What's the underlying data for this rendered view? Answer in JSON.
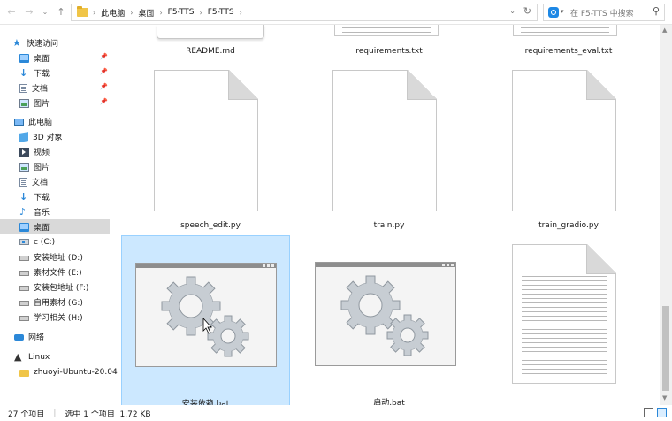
{
  "address": {
    "breadcrumbs": [
      "此电脑",
      "桌面",
      "F5-TTS",
      "F5-TTS"
    ]
  },
  "search": {
    "placeholder": "在 F5-TTS 中搜索"
  },
  "sidebar": {
    "items": [
      {
        "label": "快速访问",
        "icon": "quick-access-star",
        "pinned": false
      },
      {
        "label": "桌面",
        "icon": "desktop",
        "pinned": true
      },
      {
        "label": "下载",
        "icon": "download",
        "pinned": true
      },
      {
        "label": "文档",
        "icon": "documents",
        "pinned": true
      },
      {
        "label": "图片",
        "icon": "pictures",
        "pinned": true
      },
      {
        "label": "此电脑",
        "icon": "this-pc",
        "pinned": false
      },
      {
        "label": "3D 对象",
        "icon": "3d-objects",
        "pinned": false
      },
      {
        "label": "视频",
        "icon": "videos",
        "pinned": false
      },
      {
        "label": "图片",
        "icon": "pictures",
        "pinned": false
      },
      {
        "label": "文档",
        "icon": "documents",
        "pinned": false
      },
      {
        "label": "下载",
        "icon": "download",
        "pinned": false
      },
      {
        "label": "音乐",
        "icon": "music",
        "pinned": false
      },
      {
        "label": "桌面",
        "icon": "desktop",
        "pinned": false,
        "selected": true
      },
      {
        "label": "c (C:)",
        "icon": "drive-c",
        "pinned": false
      },
      {
        "label": "安装地址 (D:)",
        "icon": "drive",
        "pinned": false
      },
      {
        "label": "素材文件 (E:)",
        "icon": "drive",
        "pinned": false
      },
      {
        "label": "安装包地址 (F:)",
        "icon": "drive",
        "pinned": false
      },
      {
        "label": "自用素材 (G:)",
        "icon": "drive",
        "pinned": false
      },
      {
        "label": "学习相关 (H:)",
        "icon": "drive",
        "pinned": false
      },
      {
        "label": "网络",
        "icon": "network",
        "pinned": false
      },
      {
        "label": "Linux",
        "icon": "linux",
        "pinned": false
      },
      {
        "label": "zhuoyi-Ubuntu-20.04",
        "icon": "folder",
        "pinned": false
      }
    ]
  },
  "files": [
    {
      "name": "README.md",
      "type": "doc-cut"
    },
    {
      "name": "requirements.txt",
      "type": "doc-cut"
    },
    {
      "name": "requirements_eval.txt",
      "type": "doc-cut"
    },
    {
      "name": "speech_edit.py",
      "type": "blank"
    },
    {
      "name": "train.py",
      "type": "blank"
    },
    {
      "name": "train_gradio.py",
      "type": "blank"
    },
    {
      "name": "安装依赖.bat",
      "type": "bat",
      "selected": true
    },
    {
      "name": "启动.bat",
      "type": "bat"
    },
    {
      "name": "",
      "type": "text"
    }
  ],
  "status": {
    "count": "27 个项目",
    "selection": "选中 1 个项目  1.72 KB"
  }
}
